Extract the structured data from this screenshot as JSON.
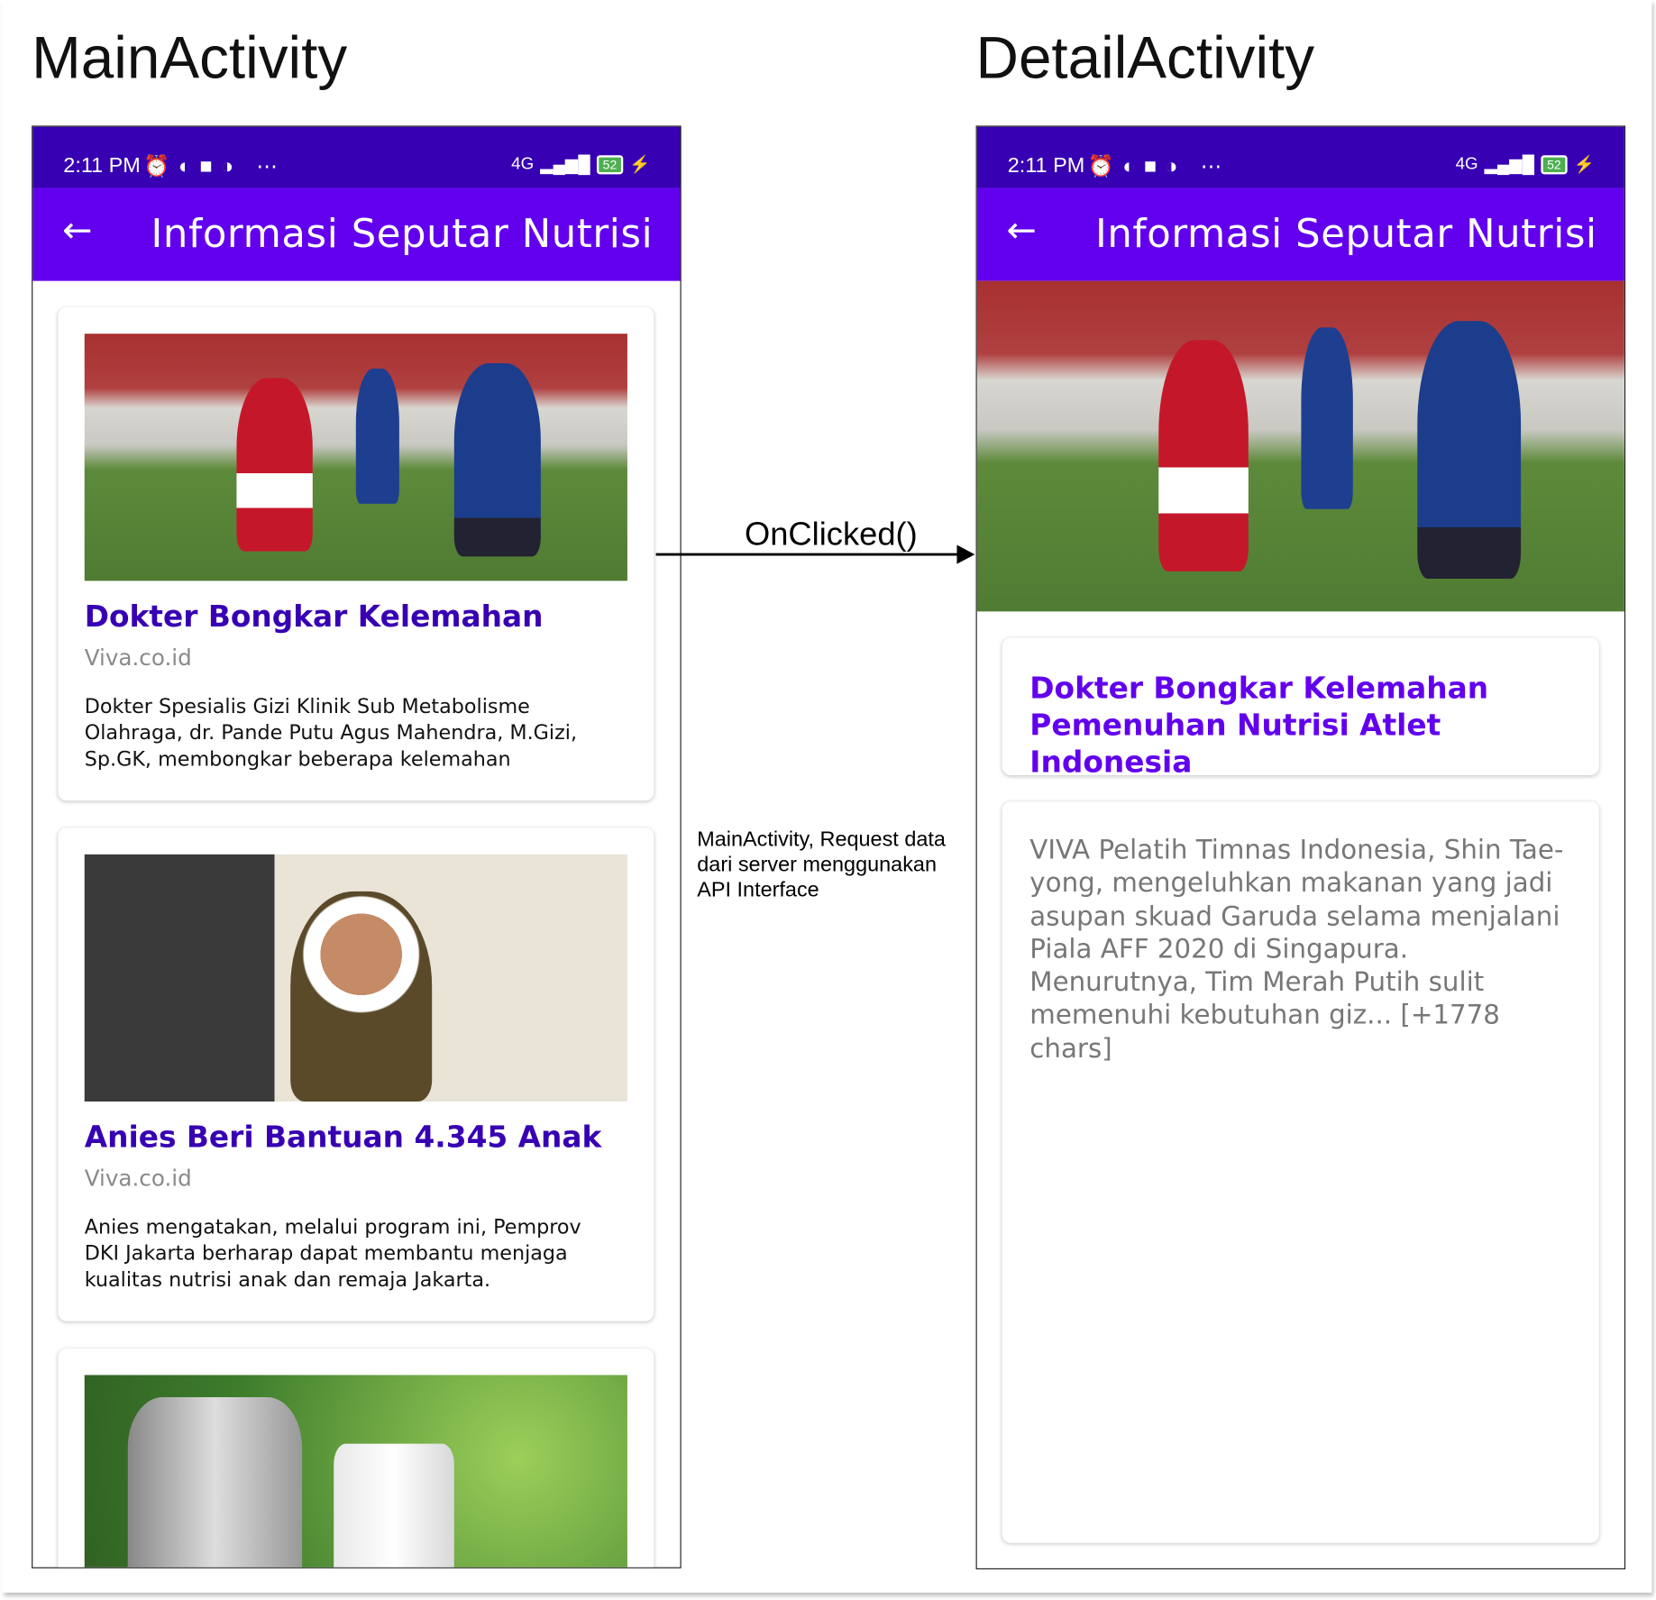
{
  "headings": {
    "main": "MainActivity",
    "detail": "DetailActivity"
  },
  "status_bar": {
    "time": "2:11 PM",
    "network": "4G",
    "battery": "52"
  },
  "toolbar": {
    "title": "Informasi Seputar Nutrisi",
    "back_icon": "arrow-left-icon"
  },
  "main_list": [
    {
      "title": "Dokter Bongkar Kelemahan",
      "source": "Viva.co.id",
      "description": "Dokter Spesialis Gizi Klinik Sub Metabolisme Olahraga, dr. Pande Putu Agus Mahendra, M.Gizi, Sp.GK, membongkar beberapa kelemahan"
    },
    {
      "title": "Anies Beri Bantuan 4.345 Anak",
      "source": "Viva.co.id",
      "description": "Anies mengatakan, melalui program ini, Pemprov DKI Jakarta berharap dapat membantu menjaga kualitas nutrisi anak dan remaja Jakarta."
    }
  ],
  "arrow": {
    "label": "OnClicked()"
  },
  "note": "MainActivity, Request data dari server menggunakan API Interface",
  "detail": {
    "title": "Dokter Bongkar Kelemahan Pemenuhan Nutrisi Atlet Indonesia",
    "content": "VIVA  Pelatih Timnas Indonesia, Shin Tae-yong, mengeluhkan makanan yang jadi asupan skuad Garuda selama menjalani Piala AFF 2020 di Singapura. Menurutnya, Tim Merah Putih sulit memenuhi kebutuhan giz... [+1778 chars]"
  },
  "colors": {
    "status": "#3700b3",
    "toolbar": "#6200ee",
    "list_title": "#3700b3",
    "detail_title": "#6200ee"
  }
}
